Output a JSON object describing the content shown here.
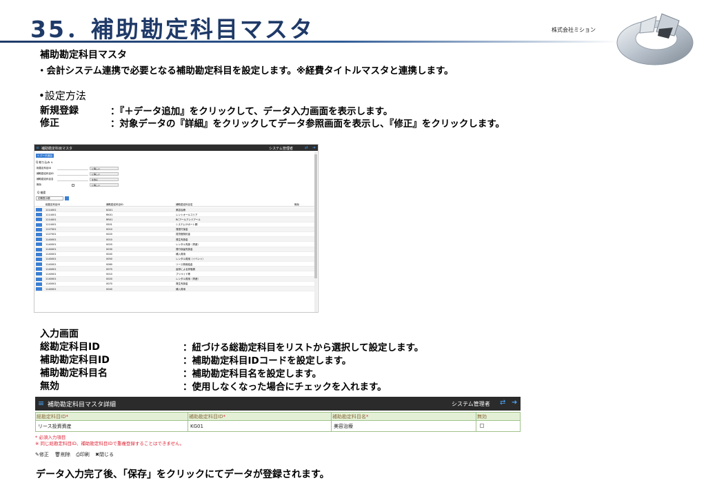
{
  "header": {
    "title": "35．補助勘定科目マスタ",
    "company": "株式会社ミション"
  },
  "intro": {
    "heading": "補助勘定科目マスタ",
    "line": "・会計システム連携で必要となる補助勘定科目を設定します。※経費タイトルマスタと連携します。"
  },
  "settings": {
    "heading": "•設定方法",
    "rows": [
      {
        "label": "新規登録",
        "desc": "：『＋データ追加』をクリックして、データ入力画面を表示します。"
      },
      {
        "label": "修正",
        "desc": "：対象データの『詳細』をクリックしてデータ参照画面を表示し、『修正』をクリックします。"
      }
    ]
  },
  "list_screen": {
    "title": "補助勘定科目マスタ",
    "user": "システム管理者",
    "add_button": "+ データ追加",
    "filter_label": "Q 絞り込み ∨",
    "filters": [
      {
        "label": "総勘定科目ID",
        "op": "に等しい"
      },
      {
        "label": "補助勘定科目ID",
        "op": "に等しい"
      },
      {
        "label": "補助勘定科目名",
        "op": "を含む"
      },
      {
        "label": "無効",
        "op": "に等しい"
      }
    ],
    "search_label": "Q 検索",
    "page_select": "初期表示順",
    "columns": [
      "総勘定科目ID",
      "補助勘定科目ID",
      "補助勘定科目名",
      "無効"
    ],
    "rows": [
      [
        "1114001",
        "KG01",
        "美容治療"
      ],
      [
        "1114001",
        "RK01",
        "レントオールコリア"
      ],
      [
        "1114001",
        "RR01",
        "RCアールアンドアール"
      ],
      [
        "1114001",
        "SS01",
        "システムサポート鋼"
      ],
      [
        "1127001",
        "0010",
        "運営付保金"
      ],
      [
        "1127001",
        "0020",
        "賃貸借契約金"
      ],
      [
        "1140001",
        "0010",
        "発生売掛金"
      ],
      [
        "1140001",
        "0020",
        "レンタル売掛（資産）"
      ],
      [
        "1140001",
        "0030",
        "発行保留売掛金"
      ],
      [
        "1140001",
        "0040",
        "補入費用"
      ],
      [
        "1140001",
        "0050",
        "レンタル費用（イベント）"
      ],
      [
        "1140001",
        "0060",
        "リース費用給金"
      ],
      [
        "1140001",
        "0070",
        "返却による評価損"
      ],
      [
        "1140001",
        "0010",
        "プリペイド等"
      ],
      [
        "1140001",
        "0020",
        "レンタル費用（資産）"
      ],
      [
        "1140001",
        "0070",
        "発生売掛金"
      ],
      [
        "1140001",
        "0040",
        "補入費用"
      ]
    ]
  },
  "input_screen": {
    "heading": "入力画面",
    "rows": [
      {
        "label": "総勘定科目ID",
        "desc": "：紐づける総勘定科目をリストから選択して設定します。"
      },
      {
        "label": "補助勘定科目ID",
        "desc": "：補助勘定科目IDコードを設定します。"
      },
      {
        "label": "補助勘定科目名",
        "desc": "：補助勘定科目名を設定します。"
      },
      {
        "label": "無効",
        "desc": "：使用しなくなった場合にチェックを入れます。"
      }
    ]
  },
  "detail_screen": {
    "title": "補助勘定科目マスタ詳細",
    "user": "システム管理者",
    "columns": [
      "総勘定科目ID",
      "補助勘定科目ID",
      "補助勘定科目名",
      "無効"
    ],
    "required_mark": "*",
    "values": {
      "account_id": "リース投資資産",
      "sub_id": "KG01",
      "sub_name": "美容治療"
    },
    "note_required": "* 必須入力項目",
    "note_duplicate": "※ 同じ総勘定科目ID、補助勘定科目IDで重複登録することはできません。",
    "buttons": {
      "edit": "修正",
      "delete": "削除",
      "print": "印刷",
      "close": "閉じる"
    }
  },
  "footer": {
    "text": "データ入力完了後、「保存」をクリックにてデータが登録されます。"
  }
}
